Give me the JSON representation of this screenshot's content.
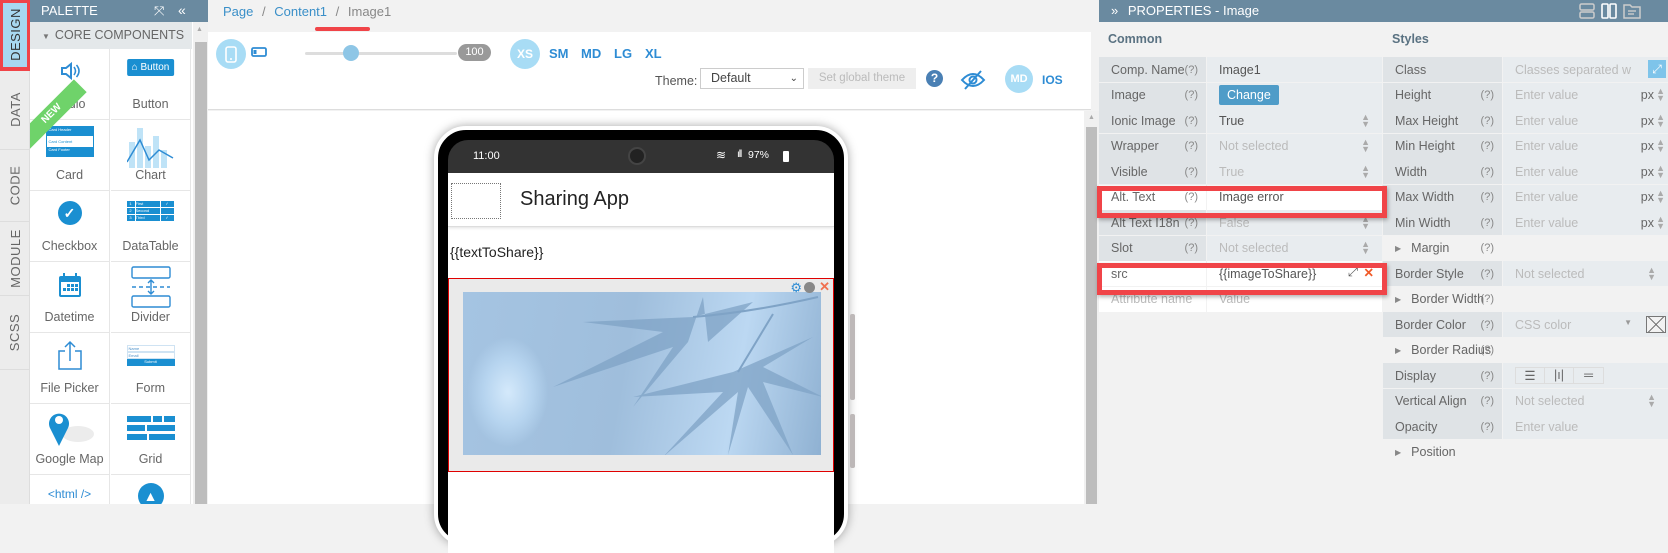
{
  "vertical_tabs": [
    {
      "label": "DESIGN",
      "active": true
    },
    {
      "label": "DATA",
      "active": false
    },
    {
      "label": "CODE",
      "active": false
    },
    {
      "label": "MODULE",
      "active": false
    },
    {
      "label": "SCSS",
      "active": false
    }
  ],
  "palette": {
    "title": "PALETTE",
    "section": "CORE COMPONENTS",
    "new_badge": "NEW",
    "items": [
      {
        "label": "Audio",
        "icon": "speaker-icon"
      },
      {
        "label": "Button",
        "icon": "button-icon"
      },
      {
        "label": "Card",
        "icon": "card-icon"
      },
      {
        "label": "Chart",
        "icon": "chart-icon"
      },
      {
        "label": "Checkbox",
        "icon": "checkbox-icon"
      },
      {
        "label": "DataTable",
        "icon": "datatable-icon"
      },
      {
        "label": "Datetime",
        "icon": "calendar-icon"
      },
      {
        "label": "Divider",
        "icon": "divider-icon"
      },
      {
        "label": "File Picker",
        "icon": "upload-icon"
      },
      {
        "label": "Form",
        "icon": "form-icon"
      },
      {
        "label": "Google Map",
        "icon": "map-pin-icon"
      },
      {
        "label": "Grid",
        "icon": "grid-icon"
      },
      {
        "label": "<html />",
        "icon": "html-icon"
      },
      {
        "label": "",
        "icon": "arrow-up-icon"
      }
    ],
    "button_icon_text": "Button",
    "card_lines": [
      "Card Header",
      "Card Content",
      "Card Footer"
    ],
    "datatable_rows": [
      [
        "1",
        "First",
        "✓"
      ],
      [
        "2",
        "Second",
        ""
      ],
      [
        "3",
        "Third",
        "✓"
      ]
    ],
    "form_lines": [
      "Name",
      "Email",
      "Submit"
    ]
  },
  "breadcrumb": [
    {
      "label": "Page"
    },
    {
      "label": "Content1"
    },
    {
      "label": "Image1"
    }
  ],
  "toolbar": {
    "zoom_value": "100",
    "zoom_fraction": 0.3,
    "breakpoints": [
      "XS",
      "SM",
      "MD",
      "LG",
      "XL"
    ],
    "active_breakpoint": "XS",
    "theme_label": "Theme:",
    "theme_value": "Default",
    "set_global_theme": "Set global theme",
    "help": "?",
    "platform_md": "MD",
    "platform_ios": "IOS"
  },
  "phone": {
    "time": "11:00",
    "battery": "97%",
    "app_title": "Sharing App",
    "text_binding": "{{textToShare}}"
  },
  "properties": {
    "header": "PROPERTIES - Image",
    "common_title": "Common",
    "styles_title": "Styles",
    "common": [
      {
        "label": "Comp. Name",
        "help": "(?)",
        "value": "Image1",
        "type": "text"
      },
      {
        "label": "Image",
        "help": "(?)",
        "value": "Change",
        "type": "button"
      },
      {
        "label": "Ionic Image",
        "help": "(?)",
        "value": "True",
        "type": "select"
      },
      {
        "label": "Wrapper",
        "help": "(?)",
        "value": "Not selected",
        "type": "select-placeholder"
      },
      {
        "label": "Visible",
        "help": "(?)",
        "value": "True",
        "type": "select-placeholder"
      },
      {
        "label": "Alt. Text",
        "help": "(?)",
        "value": "Image error",
        "type": "text-white"
      },
      {
        "label": "Alt Text I18n",
        "help": "(?)",
        "value": "False",
        "type": "select-placeholder"
      },
      {
        "label": "Slot",
        "help": "(?)",
        "value": "Not selected",
        "type": "select-placeholder"
      },
      {
        "label": "src",
        "help": "",
        "value": "{{imageToShare}}",
        "type": "attr"
      },
      {
        "label": "Attribute name",
        "help": "",
        "value": "Value",
        "type": "attr-placeholder"
      }
    ],
    "styles": [
      {
        "label": "Class",
        "help": "",
        "value": "Classes separated w",
        "type": "class"
      },
      {
        "label": "Height",
        "help": "(?)",
        "value": "Enter value",
        "unit": "px",
        "type": "unit"
      },
      {
        "label": "Max Height",
        "help": "(?)",
        "value": "Enter value",
        "unit": "px",
        "type": "unit"
      },
      {
        "label": "Min Height",
        "help": "(?)",
        "value": "Enter value",
        "unit": "px",
        "type": "unit"
      },
      {
        "label": "Width",
        "help": "(?)",
        "value": "Enter value",
        "unit": "px",
        "type": "unit"
      },
      {
        "label": "Max Width",
        "help": "(?)",
        "value": "Enter value",
        "unit": "px",
        "type": "unit"
      },
      {
        "label": "Min Width",
        "help": "(?)",
        "value": "Enter value",
        "unit": "px",
        "type": "unit"
      },
      {
        "label": "Margin",
        "help": "(?)",
        "value": "",
        "type": "expand"
      },
      {
        "label": "Border Style",
        "help": "(?)",
        "value": "Not selected",
        "type": "select"
      },
      {
        "label": "Border Width",
        "help": "(?)",
        "value": "",
        "type": "expand"
      },
      {
        "label": "Border Color",
        "help": "(?)",
        "value": "CSS color",
        "type": "color"
      },
      {
        "label": "Border Radius",
        "help": "(?)",
        "value": "",
        "type": "expand"
      },
      {
        "label": "Display",
        "help": "(?)",
        "value": "",
        "type": "display"
      },
      {
        "label": "Vertical Align",
        "help": "(?)",
        "value": "Not selected",
        "type": "select"
      },
      {
        "label": "Opacity",
        "help": "(?)",
        "value": "Enter value",
        "type": "plain"
      },
      {
        "label": "Position",
        "help": "",
        "value": "",
        "type": "expand"
      }
    ]
  }
}
